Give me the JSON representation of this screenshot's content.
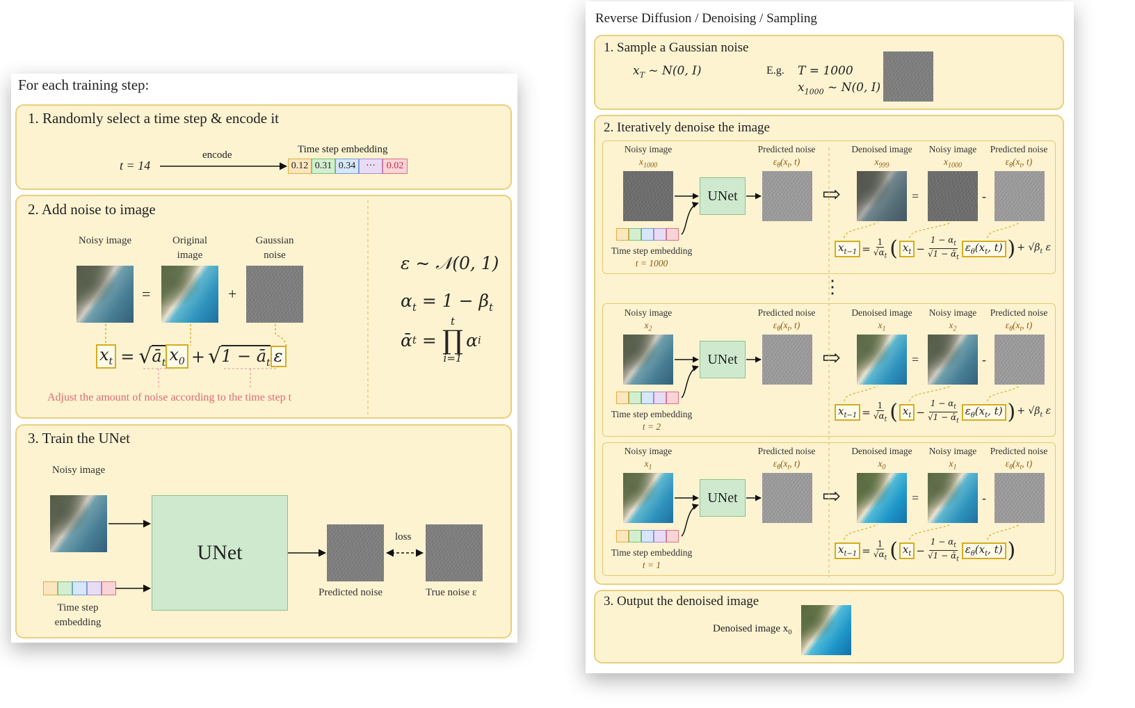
{
  "left": {
    "header": "For each training step:",
    "step1": {
      "title": "1. Randomly select a time step & encode it",
      "t_value": "t = 14",
      "encode_label": "encode",
      "embedding_label": "Time step embedding",
      "embedding_values": [
        "0.12",
        "0.31",
        "0.34",
        "···",
        "0.02"
      ],
      "embedding_colors": [
        "#f4cf8a",
        "#b7e0b5",
        "#b6d2f2",
        "#d6c0ea",
        "#f3b0b8"
      ]
    },
    "step2": {
      "title": "2. Add noise to image",
      "noisy_label": "Noisy image",
      "original_label": "Original image",
      "gaussian_label": "Gaussian noise",
      "eq_sign": "=",
      "plus_sign": "+",
      "formula": {
        "xt": "x",
        "xt_sub": "t",
        "eq": "=",
        "sqrt_abar": "ā",
        "sqrt_abar_sub": "t",
        "x0": "x",
        "x0_sub": "0",
        "plus": "+",
        "one_minus": "1 − ā",
        "one_minus_sub": "t",
        "eps": "ε"
      },
      "note": "Adjust the amount of noise according to the time step t",
      "side_eq1": "ε ∼ 𝒩(0, 1)",
      "side_eq2": "α",
      "side_eq2_rest": " = 1 − β",
      "side_eq3_lhs": "ᾱ",
      "side_eq3_top": "t",
      "side_eq3_prod": "∏",
      "side_eq3_bottom": "i=1",
      "side_eq3_rhs": "α",
      "sub_t": "t",
      "sub_i": "i"
    },
    "step3": {
      "title": "3. Train the UNet",
      "noisy_label": "Noisy image",
      "unet_label": "UNet",
      "embedding_label": "Time step embedding",
      "predicted_label": "Predicted noise",
      "true_label": "True noise ε",
      "loss_label": "loss"
    }
  },
  "right": {
    "header": "Reverse Diffusion / Denoising / Sampling",
    "step1": {
      "title": "1. Sample a Gaussian noise",
      "eq": "x",
      "eq_sub": "T",
      "eq_rest": " ~ N(0, I)",
      "eg": "E.g.",
      "eg_T": "T = 1000",
      "eg_x": "x",
      "eg_x_sub": "1000",
      "eg_x_rest": " ~ N(0, I)"
    },
    "step2": {
      "title": "2. Iteratively denoise the image",
      "rows": [
        {
          "noisy_label": "Noisy image",
          "noisy_var": "x",
          "noisy_sub": "1000",
          "pred_label": "Predicted noise",
          "pred_var": "ε",
          "pred_sub": "θ",
          "pred_args": "(x",
          "pred_args_sub": "t",
          "pred_args_end": ", t)",
          "den_label": "Denoised image",
          "den_var": "x",
          "den_sub": "999",
          "noisy2_label": "Noisy image",
          "noisy2_var": "x",
          "noisy2_sub": "1000",
          "pred2_label": "Predicted noise",
          "pred2_var": "ε",
          "pred2_sub": "θ",
          "pred2_args": "(x",
          "pred2_args_sub": "t",
          "pred2_args_end": ", t)",
          "emb_label": "Time step embedding",
          "t_label": "t = 1000",
          "unet": "UNet",
          "eq": "=",
          "minus": "-",
          "has_beta": true
        },
        {
          "noisy_label": "Noisy image",
          "noisy_var": "x",
          "noisy_sub": "2",
          "pred_label": "Predicted noise",
          "pred_var": "ε",
          "pred_sub": "θ",
          "pred_args": "(x",
          "pred_args_sub": "t",
          "pred_args_end": ", t)",
          "den_label": "Denoised image",
          "den_var": "x",
          "den_sub": "1",
          "noisy2_label": "Noisy image",
          "noisy2_var": "x",
          "noisy2_sub": "2",
          "pred2_label": "Predicted noise",
          "pred2_var": "ε",
          "pred2_sub": "θ",
          "pred2_args": "(x",
          "pred2_args_sub": "t",
          "pred2_args_end": ", t)",
          "emb_label": "Time step embedding",
          "t_label": "t = 2",
          "unet": "UNet",
          "eq": "=",
          "minus": "-",
          "has_beta": true
        },
        {
          "noisy_label": "Noisy image",
          "noisy_var": "x",
          "noisy_sub": "1",
          "pred_label": "Predicted noise",
          "pred_var": "ε",
          "pred_sub": "θ",
          "pred_args": "(x",
          "pred_args_sub": "t",
          "pred_args_end": ", t)",
          "den_label": "Denoised image",
          "den_var": "x",
          "den_sub": "0",
          "noisy2_label": "Noisy image",
          "noisy2_var": "x",
          "noisy2_sub": "1",
          "pred2_label": "Predicted noise",
          "pred2_var": "ε",
          "pred2_sub": "θ",
          "pred2_args": "(x",
          "pred2_args_sub": "t",
          "pred2_args_end": ", t)",
          "emb_label": "Time step embedding",
          "t_label": "t = 1",
          "unet": "UNet",
          "eq": "=",
          "minus": "-",
          "has_beta": false
        }
      ],
      "ellipsis": "⋮",
      "formula": {
        "lhs": "x",
        "lhs_sub": "t−1",
        "eq": "=",
        "f1_num": "1",
        "f1_den": "√α",
        "f1_den_sub": "t",
        "xt": "x",
        "xt_sub": "t",
        "minus": "−",
        "f2_num": "1 − α",
        "f2_num_sub": "t",
        "f2_den": "√1 − ᾱ",
        "f2_den_sub": "t",
        "eps": "ε",
        "eps_sub": "θ",
        "eps_args": "(x",
        "eps_args_sub": "t",
        "eps_args_end": ", t)",
        "beta": "+ √β",
        "beta_sub": "t",
        "beta_eps": " ε"
      },
      "embedding_colors": [
        "#f4cf8a",
        "#b7e0b5",
        "#b6d2f2",
        "#d6c0ea",
        "#f3b0b8"
      ]
    },
    "step3": {
      "title": "3. Output the denoised image",
      "label": "Denoised image x",
      "label_sub": "0"
    }
  }
}
